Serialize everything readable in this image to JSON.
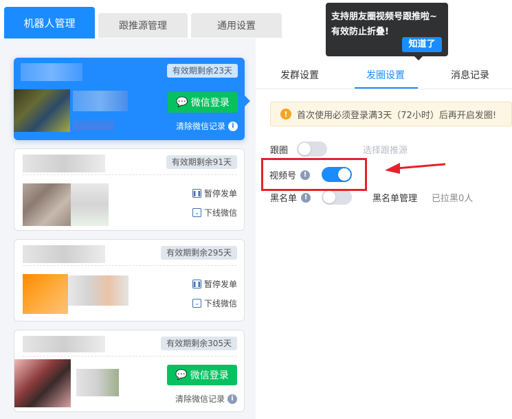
{
  "top_tabs": [
    "机器人管理",
    "跟推源管理",
    "通用设置"
  ],
  "tooltip": {
    "line1": "支持朋友圈视频号跟推啦~",
    "line2": "有效防止折叠!",
    "button": "知道了"
  },
  "cards": [
    {
      "validity": "有效期剩余23天",
      "login_button": "微信登录",
      "clear_link": "清除微信记录"
    },
    {
      "validity": "有效期剩余91天",
      "pause": "暂停发单",
      "offline": "下线微信"
    },
    {
      "validity": "有效期剩余295天",
      "pause": "暂停发单",
      "offline": "下线微信"
    },
    {
      "validity": "有效期剩余305天",
      "login_button": "微信登录",
      "clear_link": "清除微信记录"
    }
  ],
  "sub_tabs": [
    "发群设置",
    "发圈设置",
    "消息记录"
  ],
  "notice": "首次使用必须登录满3天（72小时）后再开启发圈!",
  "settings": {
    "follow_label": "跟圈",
    "follow_on": false,
    "follow_source": "选择跟推源",
    "video_label": "视频号",
    "video_on": true,
    "blacklist_label": "黑名单",
    "blacklist_on": false,
    "blacklist_manage": "黑名单管理",
    "blacklist_count": "已拉黑0人"
  },
  "colors": {
    "primary": "#1a8cff",
    "wechat_green": "#07c160",
    "highlight_red": "#e8202a",
    "warning": "#f5a623"
  }
}
